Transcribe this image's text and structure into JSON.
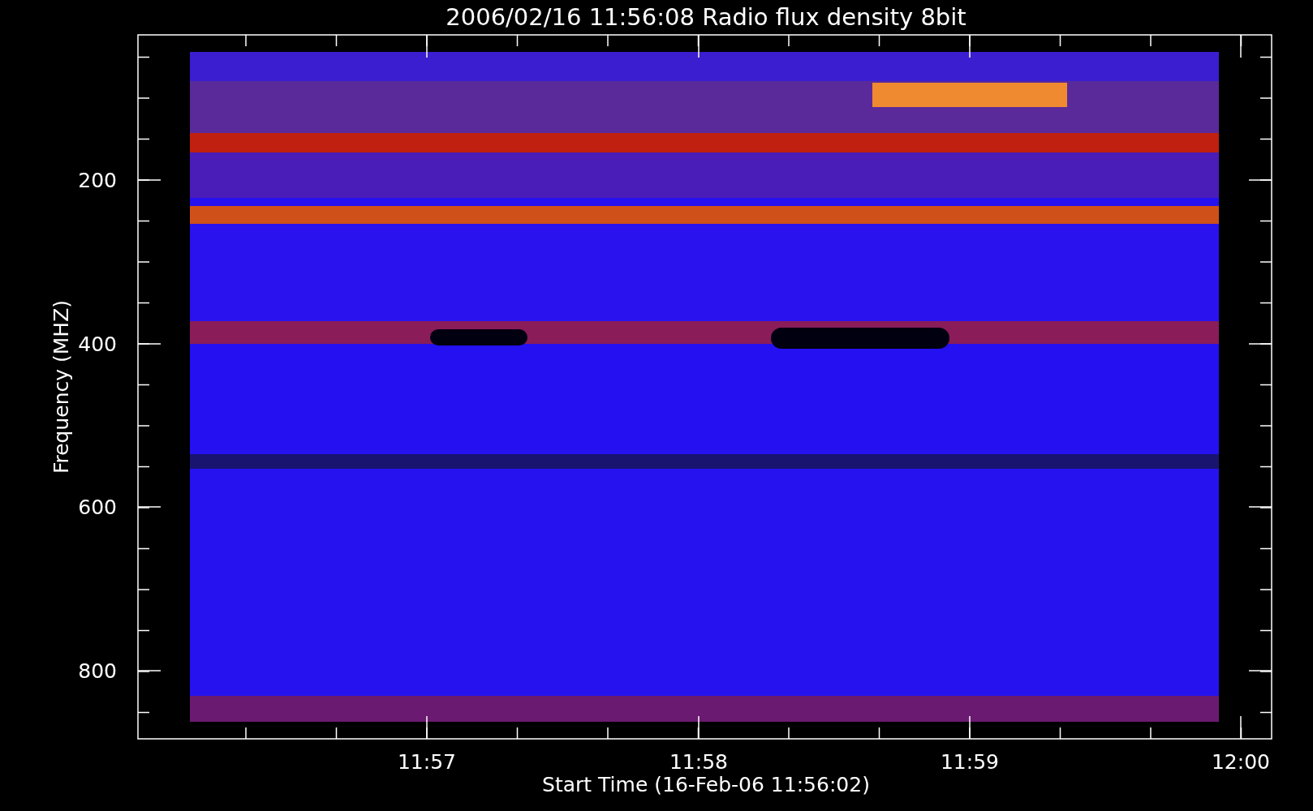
{
  "plot": {
    "title": "2006/02/16 11:56:08 Radio flux density 8bit",
    "x_axis": {
      "label": "Start Time (16-Feb-06 11:56:02)",
      "tick_labels": [
        "11:57",
        "11:58",
        "11:59",
        "12:00"
      ]
    },
    "y_axis": {
      "label": "Frequency (MHZ)",
      "tick_labels": [
        "200",
        "400",
        "600",
        "800"
      ]
    }
  }
}
